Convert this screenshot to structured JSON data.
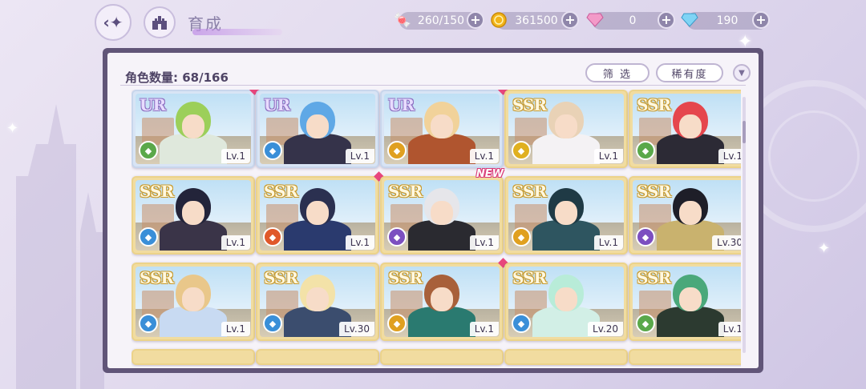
{
  "header": {
    "title": "育成"
  },
  "resources": [
    {
      "name": "candy",
      "icon": "candy-icon",
      "value": "260/150"
    },
    {
      "name": "gold-coin",
      "icon": "coin-icon",
      "value": "361500"
    },
    {
      "name": "pink-diamond",
      "icon": "pink-diamond-icon",
      "value": "0"
    },
    {
      "name": "blue-diamond",
      "icon": "blue-diamond-icon",
      "value": "190"
    }
  ],
  "panel": {
    "count_label": "角色数量: 68/166",
    "filter_label": "筛 选",
    "sort_label": "稀有度"
  },
  "colors": {
    "panel_frame": "#615578",
    "ur_frame": "#d8e4f5",
    "ssr_frame": "#f1dca0",
    "gem": "#e8467c"
  },
  "cards": [
    {
      "rarity": "UR",
      "level": "Lv.1",
      "hair": "#9ccf5a",
      "outfit": "#dfe8dc",
      "attr_color": "#5aa84a",
      "gem": true,
      "new": false
    },
    {
      "rarity": "UR",
      "level": "Lv.1",
      "hair": "#5fa8e6",
      "outfit": "#35334a",
      "attr_color": "#3a8fd8",
      "gem": false,
      "new": false
    },
    {
      "rarity": "UR",
      "level": "Lv.1",
      "hair": "#f1d29a",
      "outfit": "#b0552f",
      "attr_color": "#e0a020",
      "gem": true,
      "new": false
    },
    {
      "rarity": "SSR",
      "level": "Lv.1",
      "hair": "#e9d2b6",
      "outfit": "#f4f2f4",
      "attr_color": "#e0b020",
      "gem": false,
      "new": false
    },
    {
      "rarity": "SSR",
      "level": "Lv.1",
      "hair": "#e5464d",
      "outfit": "#2c2a35",
      "attr_color": "#5aa84a",
      "gem": false,
      "new": false
    },
    {
      "rarity": "SSR",
      "level": "Lv.1",
      "hair": "#23243a",
      "outfit": "#3a3448",
      "attr_color": "#3a8fd8",
      "gem": false,
      "new": false
    },
    {
      "rarity": "SSR",
      "level": "Lv.1",
      "hair": "#2b3050",
      "outfit": "#2a3a6e",
      "attr_color": "#e0582a",
      "gem": true,
      "new": false
    },
    {
      "rarity": "SSR",
      "level": "Lv.1",
      "hair": "#e6e6ea",
      "outfit": "#2a2a30",
      "attr_color": "#7c4fc0",
      "gem": false,
      "new": true
    },
    {
      "rarity": "SSR",
      "level": "Lv.1",
      "hair": "#1f3a45",
      "outfit": "#2e5560",
      "attr_color": "#e0a020",
      "gem": false,
      "new": false
    },
    {
      "rarity": "SSR",
      "level": "Lv.30",
      "hair": "#1e1e28",
      "outfit": "#c9b26e",
      "attr_color": "#7c4fc0",
      "gem": false,
      "new": false
    },
    {
      "rarity": "SSR",
      "level": "Lv.1",
      "hair": "#e9c78a",
      "outfit": "#c8daf2",
      "attr_color": "#3a8fd8",
      "gem": false,
      "new": false
    },
    {
      "rarity": "SSR",
      "level": "Lv.30",
      "hair": "#f3e2a8",
      "outfit": "#3b4d6e",
      "attr_color": "#3a8fd8",
      "gem": false,
      "new": false
    },
    {
      "rarity": "SSR",
      "level": "Lv.1",
      "hair": "#a8603a",
      "outfit": "#2a7a70",
      "attr_color": "#e0a020",
      "gem": true,
      "new": false
    },
    {
      "rarity": "SSR",
      "level": "Lv.20",
      "hair": "#b8ecd8",
      "outfit": "#d2efe6",
      "attr_color": "#3a8fd8",
      "gem": false,
      "new": false
    },
    {
      "rarity": "SSR",
      "level": "Lv.1",
      "hair": "#4aa87a",
      "outfit": "#2c3a30",
      "attr_color": "#5aa84a",
      "gem": false,
      "new": false
    }
  ],
  "partial_row_count": 5
}
